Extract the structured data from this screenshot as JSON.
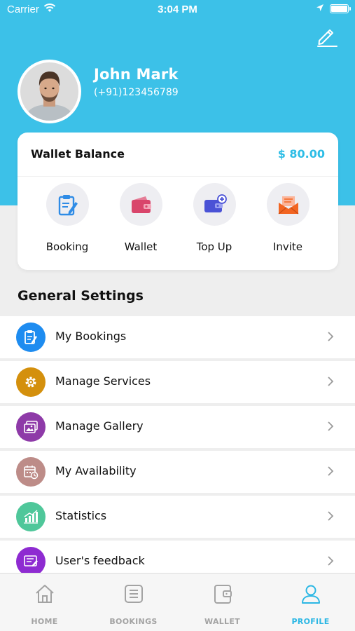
{
  "status_bar": {
    "carrier": "Carrier",
    "time": "3:04 PM"
  },
  "profile": {
    "name": "John Mark",
    "phone": "(+91)123456789"
  },
  "wallet": {
    "label": "Wallet Balance",
    "amount": "$ 80.00",
    "amount_color": "#2dbde6"
  },
  "quick_actions": [
    {
      "label": "Booking",
      "icon": "booking-clipboard-icon",
      "color": "#2f8ce6"
    },
    {
      "label": "Wallet",
      "icon": "wallet-icon",
      "color": "#d9456b"
    },
    {
      "label": "Top Up",
      "icon": "top-up-wallet-icon",
      "color": "#4a52d6"
    },
    {
      "label": "Invite",
      "icon": "envelope-icon",
      "color": "#f26522"
    }
  ],
  "general_settings": {
    "title": "General Settings",
    "items": [
      {
        "label": "My Bookings",
        "icon": "clipboard-icon",
        "color": "#1e8cf0"
      },
      {
        "label": "Manage Services",
        "icon": "gear-icon",
        "color": "#d4900d"
      },
      {
        "label": "Manage Gallery",
        "icon": "gallery-icon",
        "color": "#8e3aa8"
      },
      {
        "label": "My Availability",
        "icon": "calendar-clock-icon",
        "color": "#bd8c88"
      },
      {
        "label": "Statistics",
        "icon": "bar-chart-icon",
        "color": "#4fc79a"
      },
      {
        "label": "User's feedback",
        "icon": "feedback-icon",
        "color": "#8e2bd1"
      }
    ]
  },
  "bottom_nav": {
    "items": [
      {
        "label": "HOME",
        "icon": "home-icon"
      },
      {
        "label": "BOOKINGS",
        "icon": "list-icon"
      },
      {
        "label": "WALLET",
        "icon": "wallet-icon"
      },
      {
        "label": "PROFILE",
        "icon": "profile-icon"
      }
    ],
    "active": "PROFILE",
    "active_color": "#2bb7e4",
    "inactive_color": "#a3a3a3"
  }
}
